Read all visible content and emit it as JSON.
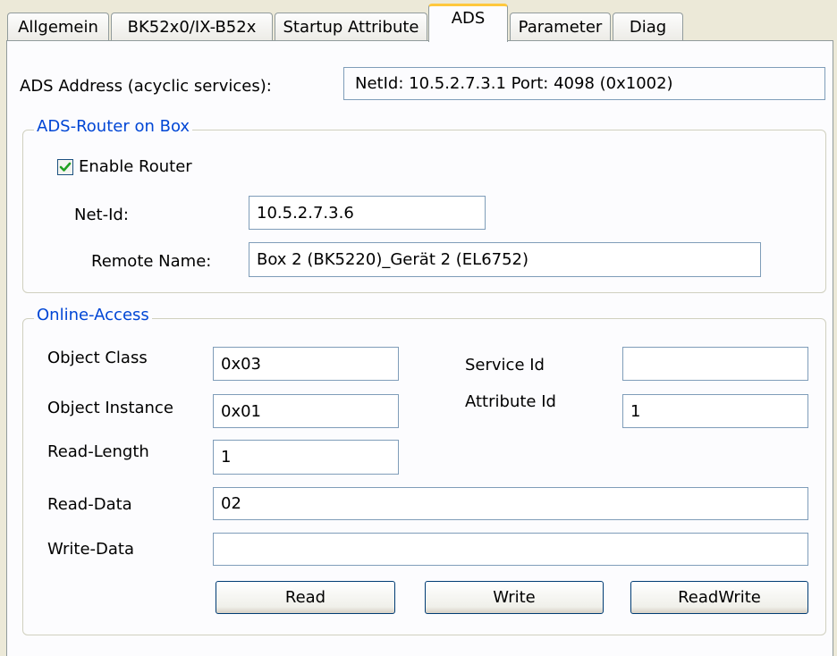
{
  "tabs": [
    {
      "label": "Allgemein"
    },
    {
      "label": "BK52x0/IX-B52x"
    },
    {
      "label": "Startup Attribute"
    },
    {
      "label": "ADS"
    },
    {
      "label": "Parameter"
    },
    {
      "label": "Diag"
    }
  ],
  "active_tab": "ADS",
  "ads_address": {
    "label": "ADS Address (acyclic services):",
    "value": "NetId: 10.5.2.7.3.1    Port: 4098 (0x1002)"
  },
  "router": {
    "title": "ADS-Router on Box",
    "enable_label": "Enable Router",
    "enable_checked": true,
    "net_id_label": "Net-Id:",
    "net_id_value": "10.5.2.7.3.6",
    "remote_name_label": "Remote Name:",
    "remote_name_value": "Box 2  (BK5220)_Gerät 2 (EL6752)"
  },
  "online": {
    "title": "Online-Access",
    "object_class_label": "Object Class",
    "object_class_value": "0x03",
    "object_instance_label": "Object Instance",
    "object_instance_value": "0x01",
    "read_length_label": "Read-Length",
    "read_length_value": "1",
    "service_id_label": "Service Id",
    "service_id_value": "",
    "attribute_id_label": "Attribute Id",
    "attribute_id_value": "1",
    "read_data_label": "Read-Data",
    "read_data_value": "02",
    "write_data_label": "Write-Data",
    "write_data_value": "",
    "buttons": {
      "read": "Read",
      "write": "Write",
      "readwrite": "ReadWrite"
    }
  },
  "colors": {
    "group_title": "#0046d5",
    "active_tab_accent": "#ffc83c",
    "checkmark": "#21a121"
  }
}
